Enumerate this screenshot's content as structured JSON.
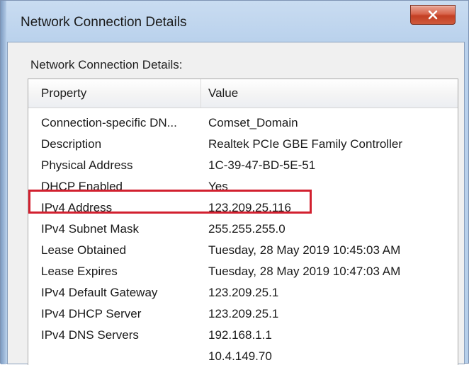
{
  "window": {
    "title": "Network Connection Details",
    "close_icon": "close-icon",
    "close_color": "#c94a2e"
  },
  "group": {
    "label": "Network Connection Details:"
  },
  "table": {
    "headers": [
      "Property",
      "Value"
    ],
    "rows": [
      {
        "property": "Connection-specific DN...",
        "value": "Comset_Domain"
      },
      {
        "property": "Description",
        "value": "Realtek PCIe GBE Family Controller"
      },
      {
        "property": "Physical Address",
        "value": "1C-39-47-BD-5E-51"
      },
      {
        "property": "DHCP Enabled",
        "value": "Yes"
      },
      {
        "property": "IPv4 Address",
        "value": "123.209.25.116"
      },
      {
        "property": "IPv4 Subnet Mask",
        "value": "255.255.255.0"
      },
      {
        "property": "Lease Obtained",
        "value": "Tuesday, 28 May 2019 10:45:03 AM"
      },
      {
        "property": "Lease Expires",
        "value": "Tuesday, 28 May 2019 10:47:03 AM"
      },
      {
        "property": "IPv4 Default Gateway",
        "value": "123.209.25.1"
      },
      {
        "property": "IPv4 DHCP Server",
        "value": "123.209.25.1"
      },
      {
        "property": "IPv4 DNS Servers",
        "value": "192.168.1.1"
      },
      {
        "property": "",
        "value": "10.4.149.70"
      }
    ],
    "highlight_color": "#d2202f"
  }
}
